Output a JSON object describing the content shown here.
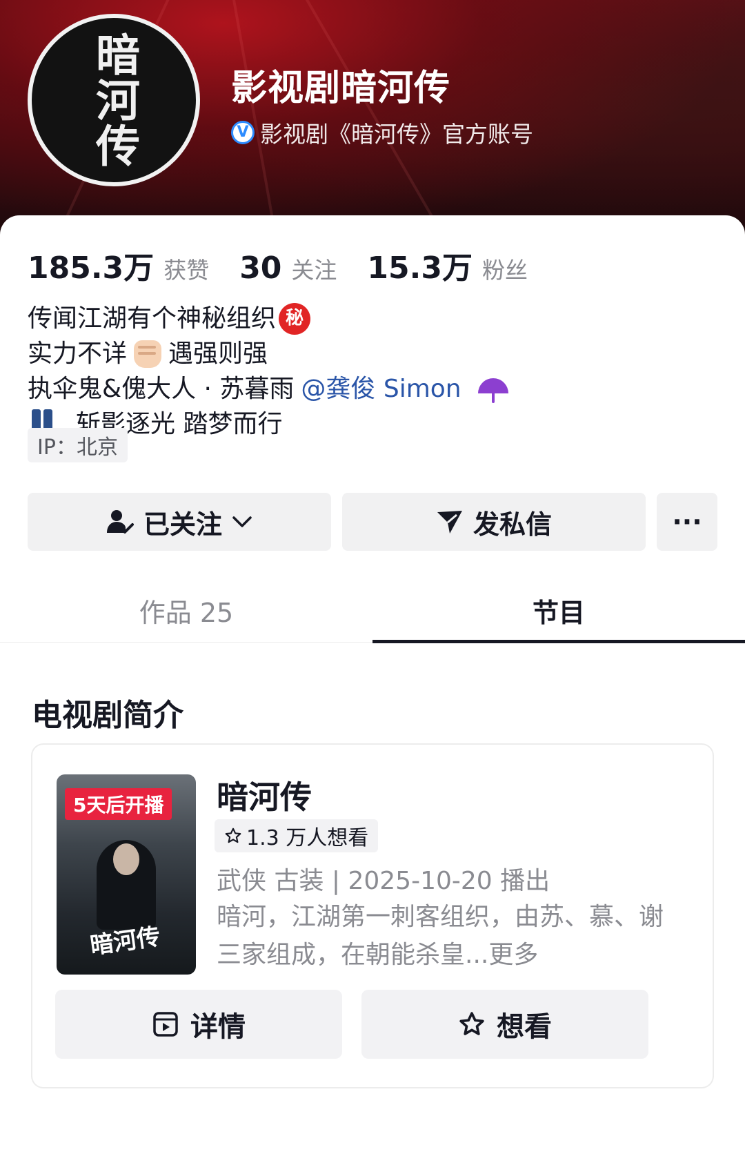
{
  "profile": {
    "avatar_text": "暗河传",
    "name": "影视剧暗河传",
    "verified_badge": "V",
    "verified_text": "影视剧《暗河传》官方账号"
  },
  "stats": [
    {
      "value": "185.3万",
      "label": "获赞"
    },
    {
      "value": "30",
      "label": "关注"
    },
    {
      "value": "15.3万",
      "label": "粉丝"
    }
  ],
  "bio": {
    "line1": "传闻江湖有个神秘组织",
    "line1_badge": "秘",
    "line2_a": "实力不详",
    "line2_b": "遇强则强",
    "line3": "执伞鬼&傀大人 · 苏暮雨",
    "line3_mention": "@龚俊 Simon",
    "line4": "斩影逐光 踏梦而行"
  },
  "ip_tag": "IP：北京",
  "actions": {
    "follow_label": "已关注",
    "message_label": "发私信",
    "more_label": "···"
  },
  "tabs": [
    {
      "label": "作品 25",
      "active": false
    },
    {
      "label": "节目",
      "active": true
    }
  ],
  "section_title": "电视剧简介",
  "drama": {
    "poster_badge": "5天后开播",
    "poster_title": "暗河传",
    "title": "暗河传",
    "want_count": "1.3 万人想看",
    "meta": "武侠 古装 | 2025-10-20 播出",
    "description": "暗河，江湖第一刺客组织，由苏、慕、谢三家组成，在朝能杀皇",
    "more_label": "...更多",
    "details_label": "详情",
    "want_label": "想看"
  },
  "colors": {
    "accent_badge": "#e8233f",
    "verified_blue": "#2d8cff",
    "mention_blue": "#2a55a8"
  }
}
